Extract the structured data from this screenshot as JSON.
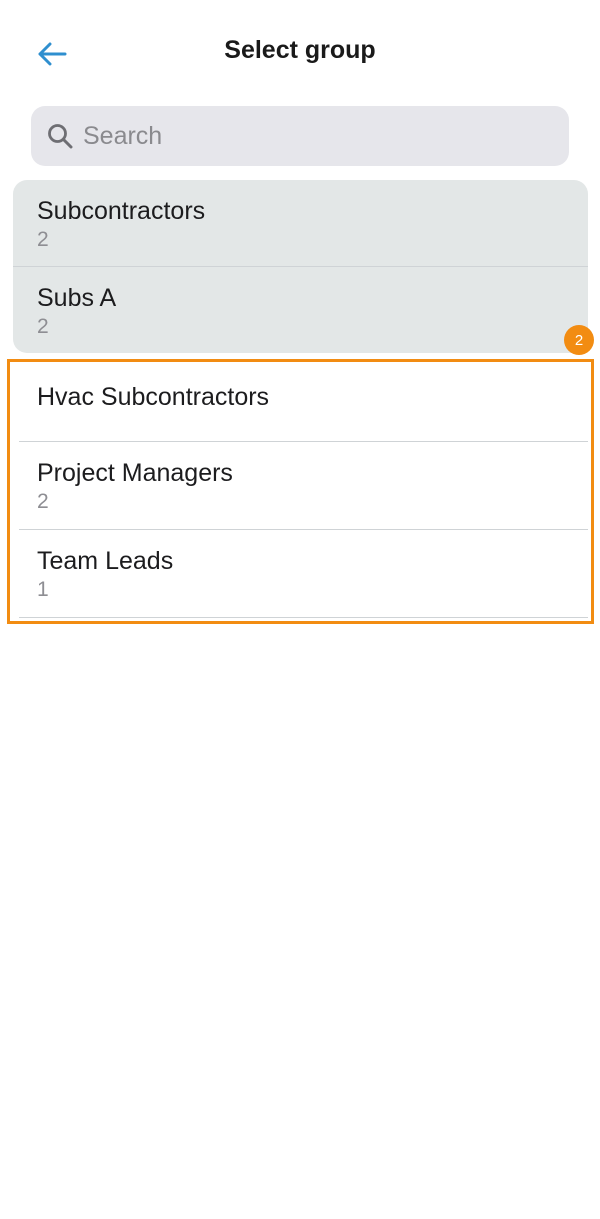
{
  "header": {
    "title": "Select group",
    "back_icon": "arrow-left-icon",
    "accent_color": "#2f8fcf"
  },
  "search": {
    "placeholder": "Search",
    "value": "",
    "icon": "search-icon"
  },
  "groups": [
    {
      "name": "Subcontractors",
      "count": "2",
      "selected": true
    },
    {
      "name": "Subs A",
      "count": "2",
      "selected": true
    },
    {
      "name": "Hvac Subcontractors",
      "count": "",
      "selected": false
    },
    {
      "name": "Project Managers",
      "count": "2",
      "selected": false
    },
    {
      "name": "Team Leads",
      "count": "1",
      "selected": false
    }
  ],
  "annotation": {
    "badge_label": "2",
    "color": "#f28c12"
  }
}
